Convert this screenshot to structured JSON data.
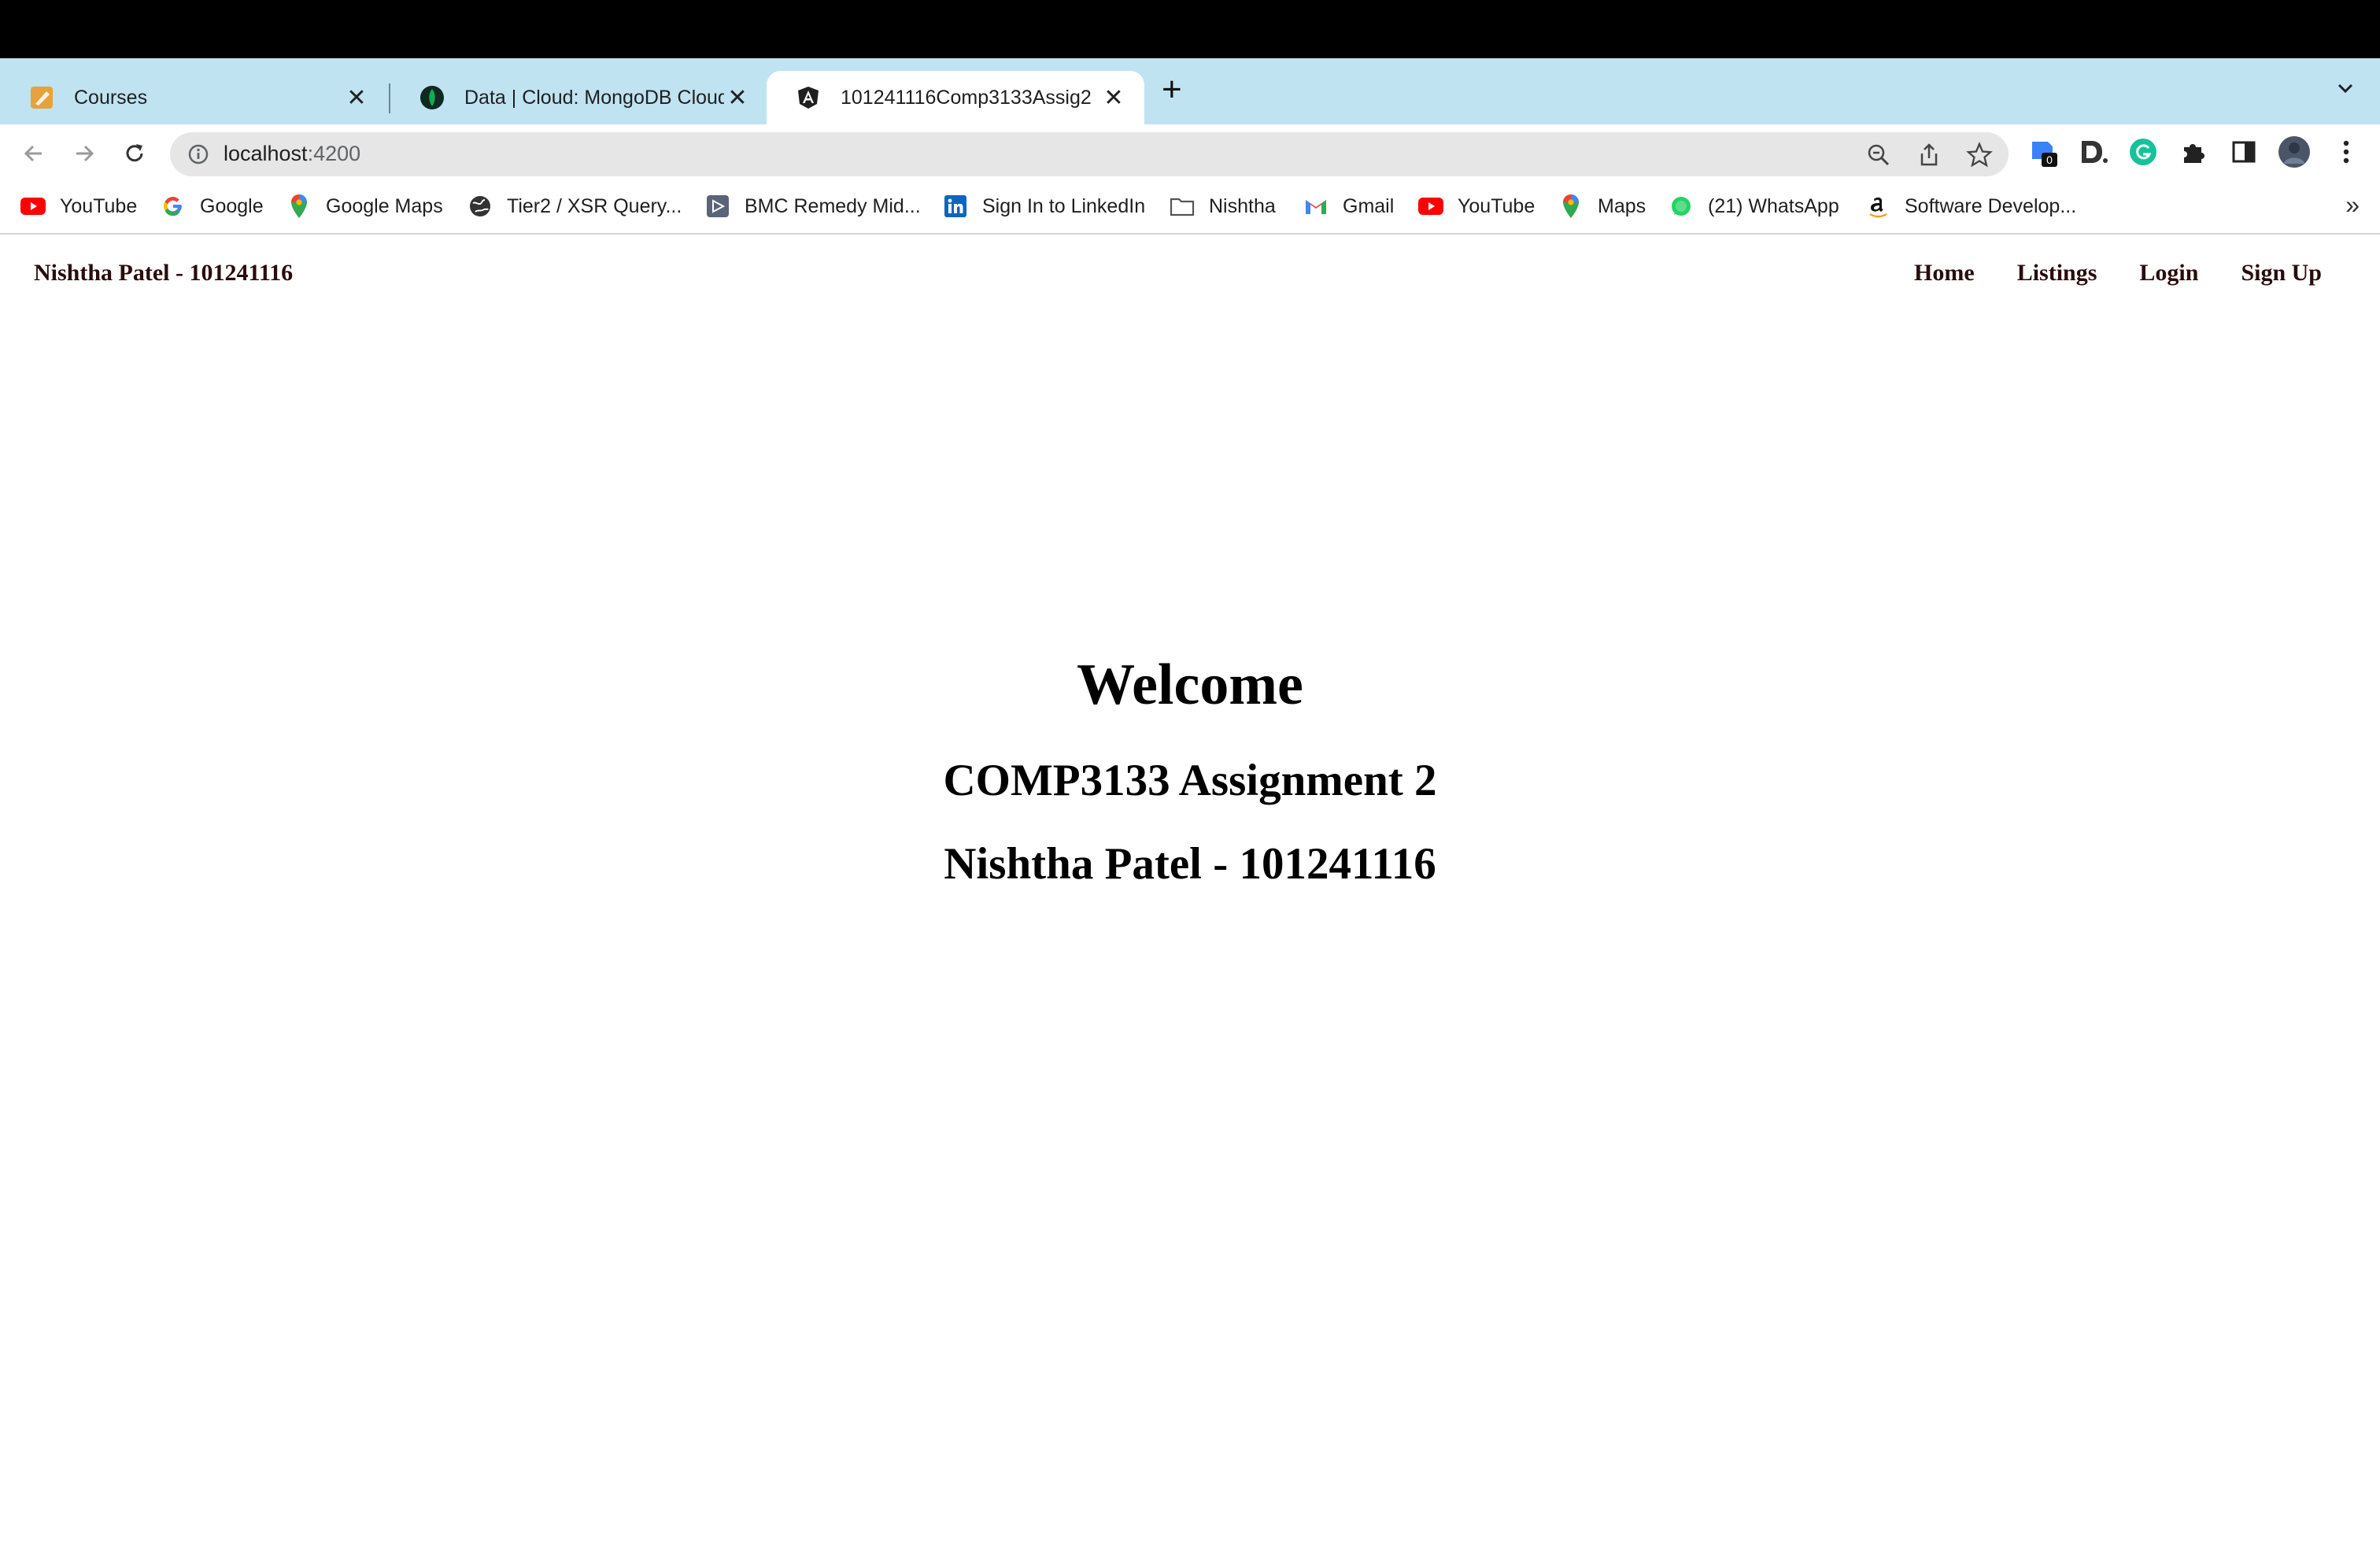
{
  "browser": {
    "tabs": [
      {
        "title": "Courses",
        "icon": "notebook-icon"
      },
      {
        "title": "Data | Cloud: MongoDB Cloud",
        "icon": "mongodb-leaf-icon"
      },
      {
        "title": "101241116Comp3133Assig2",
        "icon": "angular-icon",
        "active": true
      }
    ],
    "omnibox": {
      "host": "localhost",
      "port": ":4200"
    },
    "extensions": {
      "badge_count": "0"
    },
    "bookmarks": [
      {
        "label": "YouTube",
        "icon": "youtube-icon"
      },
      {
        "label": "Google",
        "icon": "google-icon"
      },
      {
        "label": "Google Maps",
        "icon": "maps-pin-icon"
      },
      {
        "label": "Tier2 / XSR Query...",
        "icon": "globe-icon"
      },
      {
        "label": "BMC Remedy Mid...",
        "icon": "bmc-icon"
      },
      {
        "label": "Sign In to LinkedIn",
        "icon": "linkedin-icon"
      },
      {
        "label": "Nishtha",
        "icon": "folder-icon"
      },
      {
        "label": "Gmail",
        "icon": "gmail-icon"
      },
      {
        "label": "YouTube",
        "icon": "youtube-icon"
      },
      {
        "label": "Maps",
        "icon": "maps-pin-icon"
      },
      {
        "label": "(21) WhatsApp",
        "icon": "whatsapp-icon"
      },
      {
        "label": "Software Develop...",
        "icon": "amazon-icon"
      }
    ],
    "bookmarks_overflow": "»"
  },
  "app": {
    "brand": "Nishtha Patel - 101241116",
    "nav": {
      "home": "Home",
      "listings": "Listings",
      "login": "Login",
      "signup": "Sign Up"
    },
    "hero": {
      "heading": "Welcome",
      "subheading": "COMP3133 Assignment 2",
      "author": "Nishtha Patel - 101241116"
    }
  }
}
